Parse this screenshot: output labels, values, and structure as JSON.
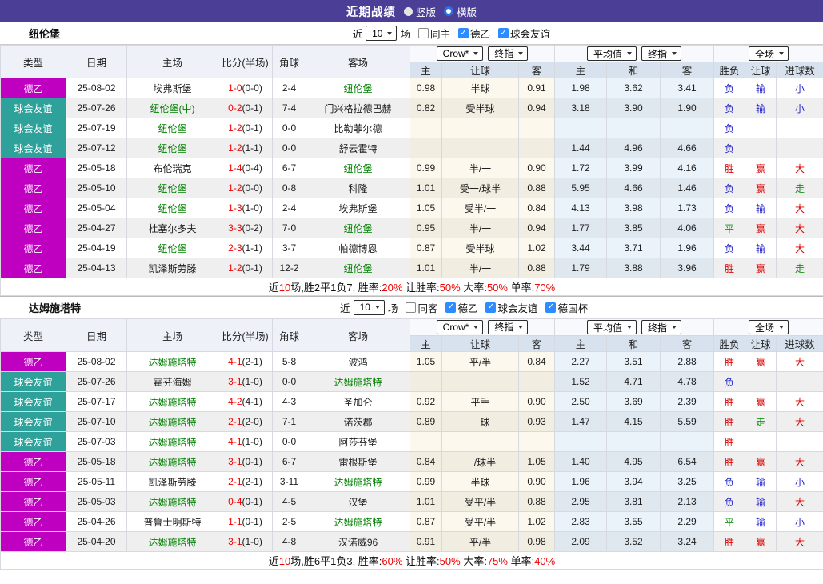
{
  "topbar": {
    "title": "近期战绩",
    "radio_vertical": "竖版",
    "radio_horizontal": "横版"
  },
  "table": {
    "left_columns": [
      "类型",
      "日期",
      "主场",
      "比分(半场)",
      "角球",
      "客场"
    ],
    "sub_columns": [
      "主",
      "让球",
      "客",
      "主",
      "和",
      "客",
      "胜负",
      "让球",
      "进球数"
    ],
    "selects": {
      "crow": "Crow*",
      "final1": "终指",
      "average": "平均值",
      "final2": "终指",
      "fullmatch": "全场"
    }
  },
  "badge_colors": {
    "德乙": "#c000c0",
    "球会友谊": "#2da19a"
  },
  "result_colors": {
    "胜": "red",
    "平": "green",
    "负": "blue",
    "赢": "red",
    "输": "blue",
    "走": "green",
    "大": "red",
    "小": "blue"
  },
  "teams": [
    {
      "name": "纽伦堡",
      "filter": {
        "near": "近",
        "count": "10",
        "games": "场",
        "uncheck_label": "同主",
        "checked": [
          "德乙",
          "球会友谊"
        ]
      },
      "rows": [
        {
          "type": "德乙",
          "date": "25-08-02",
          "home": "埃弗斯堡",
          "home_green": false,
          "score": "1-0",
          "half": "(0-0)",
          "corner": "2-4",
          "away": "纽伦堡",
          "away_green": true,
          "crow_home": "0.98",
          "handicap": "半球",
          "crow_away": "0.91",
          "avg_home": "1.98",
          "avg_draw": "3.62",
          "avg_away": "3.41",
          "res_wdl": "负",
          "res_handicap": "输",
          "res_goals": "小"
        },
        {
          "type": "球会友谊",
          "date": "25-07-26",
          "home": "纽伦堡(中)",
          "home_green": true,
          "score": "0-2",
          "half": "(0-1)",
          "corner": "7-4",
          "away": "门兴格拉德巴赫",
          "away_green": false,
          "crow_home": "0.82",
          "handicap": "受半球",
          "crow_away": "0.94",
          "avg_home": "3.18",
          "avg_draw": "3.90",
          "avg_away": "1.90",
          "res_wdl": "负",
          "res_handicap": "输",
          "res_goals": "小"
        },
        {
          "type": "球会友谊",
          "date": "25-07-19",
          "home": "纽伦堡",
          "home_green": true,
          "score": "1-2",
          "half": "(0-1)",
          "corner": "0-0",
          "away": "比勒菲尔德",
          "away_green": false,
          "crow_home": "",
          "handicap": "",
          "crow_away": "",
          "avg_home": "",
          "avg_draw": "",
          "avg_away": "",
          "res_wdl": "负",
          "res_handicap": "",
          "res_goals": ""
        },
        {
          "type": "球会友谊",
          "date": "25-07-12",
          "home": "纽伦堡",
          "home_green": true,
          "score": "1-2",
          "half": "(1-1)",
          "corner": "0-0",
          "away": "舒云霍特",
          "away_green": false,
          "crow_home": "",
          "handicap": "",
          "crow_away": "",
          "avg_home": "1.44",
          "avg_draw": "4.96",
          "avg_away": "4.66",
          "res_wdl": "负",
          "res_handicap": "",
          "res_goals": ""
        },
        {
          "type": "德乙",
          "date": "25-05-18",
          "home": "布伦瑞克",
          "home_green": false,
          "score": "1-4",
          "half": "(0-4)",
          "corner": "6-7",
          "away": "纽伦堡",
          "away_green": true,
          "crow_home": "0.99",
          "handicap": "半/一",
          "crow_away": "0.90",
          "avg_home": "1.72",
          "avg_draw": "3.99",
          "avg_away": "4.16",
          "res_wdl": "胜",
          "res_handicap": "赢",
          "res_goals": "大"
        },
        {
          "type": "德乙",
          "date": "25-05-10",
          "home": "纽伦堡",
          "home_green": true,
          "score": "1-2",
          "half": "(0-0)",
          "corner": "0-8",
          "away": "科隆",
          "away_green": false,
          "crow_home": "1.01",
          "handicap": "受一/球半",
          "crow_away": "0.88",
          "avg_home": "5.95",
          "avg_draw": "4.66",
          "avg_away": "1.46",
          "res_wdl": "负",
          "res_handicap": "赢",
          "res_goals": "走"
        },
        {
          "type": "德乙",
          "date": "25-05-04",
          "home": "纽伦堡",
          "home_green": true,
          "score": "1-3",
          "half": "(1-0)",
          "corner": "2-4",
          "away": "埃弗斯堡",
          "away_green": false,
          "crow_home": "1.05",
          "handicap": "受半/一",
          "crow_away": "0.84",
          "avg_home": "4.13",
          "avg_draw": "3.98",
          "avg_away": "1.73",
          "res_wdl": "负",
          "res_handicap": "输",
          "res_goals": "大"
        },
        {
          "type": "德乙",
          "date": "25-04-27",
          "home": "杜塞尔多夫",
          "home_green": false,
          "score": "3-3",
          "half": "(0-2)",
          "corner": "7-0",
          "away": "纽伦堡",
          "away_green": true,
          "crow_home": "0.95",
          "handicap": "半/一",
          "crow_away": "0.94",
          "avg_home": "1.77",
          "avg_draw": "3.85",
          "avg_away": "4.06",
          "res_wdl": "平",
          "res_handicap": "赢",
          "res_goals": "大"
        },
        {
          "type": "德乙",
          "date": "25-04-19",
          "home": "纽伦堡",
          "home_green": true,
          "score": "2-3",
          "half": "(1-1)",
          "corner": "3-7",
          "away": "帕德博恩",
          "away_green": false,
          "crow_home": "0.87",
          "handicap": "受半球",
          "crow_away": "1.02",
          "avg_home": "3.44",
          "avg_draw": "3.71",
          "avg_away": "1.96",
          "res_wdl": "负",
          "res_handicap": "输",
          "res_goals": "大"
        },
        {
          "type": "德乙",
          "date": "25-04-13",
          "home": "凯泽斯劳滕",
          "home_green": false,
          "score": "1-2",
          "half": "(0-1)",
          "corner": "12-2",
          "away": "纽伦堡",
          "away_green": true,
          "crow_home": "1.01",
          "handicap": "半/一",
          "crow_away": "0.88",
          "avg_home": "1.79",
          "avg_draw": "3.88",
          "avg_away": "3.96",
          "res_wdl": "胜",
          "res_handicap": "赢",
          "res_goals": "走"
        }
      ],
      "summary": [
        {
          "text": "近"
        },
        {
          "text": "10",
          "red": true
        },
        {
          "text": "场,胜2平1负7, 胜率:"
        },
        {
          "text": "20%",
          "red": true
        },
        {
          "text": " 让胜率:"
        },
        {
          "text": "50%",
          "red": true
        },
        {
          "text": " 大率:"
        },
        {
          "text": "50%",
          "red": true
        },
        {
          "text": " 单率:"
        },
        {
          "text": "70%",
          "red": true
        }
      ]
    },
    {
      "name": "达姆施塔特",
      "filter": {
        "near": "近",
        "count": "10",
        "games": "场",
        "uncheck_label": "同客",
        "checked": [
          "德乙",
          "球会友谊",
          "德国杯"
        ]
      },
      "rows": [
        {
          "type": "德乙",
          "date": "25-08-02",
          "home": "达姆施塔特",
          "home_green": true,
          "score": "4-1",
          "half": "(2-1)",
          "corner": "5-8",
          "away": "波鸿",
          "away_green": false,
          "crow_home": "1.05",
          "handicap": "平/半",
          "crow_away": "0.84",
          "avg_home": "2.27",
          "avg_draw": "3.51",
          "avg_away": "2.88",
          "res_wdl": "胜",
          "res_handicap": "赢",
          "res_goals": "大"
        },
        {
          "type": "球会友谊",
          "date": "25-07-26",
          "home": "霍芬海姆",
          "home_green": false,
          "score": "3-1",
          "half": "(1-0)",
          "corner": "0-0",
          "away": "达姆施塔特",
          "away_green": true,
          "crow_home": "",
          "handicap": "",
          "crow_away": "",
          "avg_home": "1.52",
          "avg_draw": "4.71",
          "avg_away": "4.78",
          "res_wdl": "负",
          "res_handicap": "",
          "res_goals": ""
        },
        {
          "type": "球会友谊",
          "date": "25-07-17",
          "home": "达姆施塔特",
          "home_green": true,
          "score": "4-2",
          "half": "(4-1)",
          "corner": "4-3",
          "away": "圣加仑",
          "away_green": false,
          "crow_home": "0.92",
          "handicap": "平手",
          "crow_away": "0.90",
          "avg_home": "2.50",
          "avg_draw": "3.69",
          "avg_away": "2.39",
          "res_wdl": "胜",
          "res_handicap": "赢",
          "res_goals": "大"
        },
        {
          "type": "球会友谊",
          "date": "25-07-10",
          "home": "达姆施塔特",
          "home_green": true,
          "score": "2-1",
          "half": "(2-0)",
          "corner": "7-1",
          "away": "诺茨郡",
          "away_green": false,
          "crow_home": "0.89",
          "handicap": "一球",
          "crow_away": "0.93",
          "avg_home": "1.47",
          "avg_draw": "4.15",
          "avg_away": "5.59",
          "res_wdl": "胜",
          "res_handicap": "走",
          "res_goals": "大"
        },
        {
          "type": "球会友谊",
          "date": "25-07-03",
          "home": "达姆施塔特",
          "home_green": true,
          "score": "4-1",
          "half": "(1-0)",
          "corner": "0-0",
          "away": "阿莎芬堡",
          "away_green": false,
          "crow_home": "",
          "handicap": "",
          "crow_away": "",
          "avg_home": "",
          "avg_draw": "",
          "avg_away": "",
          "res_wdl": "胜",
          "res_handicap": "",
          "res_goals": ""
        },
        {
          "type": "德乙",
          "date": "25-05-18",
          "home": "达姆施塔特",
          "home_green": true,
          "score": "3-1",
          "half": "(0-1)",
          "corner": "6-7",
          "away": "雷根斯堡",
          "away_green": false,
          "crow_home": "0.84",
          "handicap": "一/球半",
          "crow_away": "1.05",
          "avg_home": "1.40",
          "avg_draw": "4.95",
          "avg_away": "6.54",
          "res_wdl": "胜",
          "res_handicap": "赢",
          "res_goals": "大"
        },
        {
          "type": "德乙",
          "date": "25-05-11",
          "home": "凯泽斯劳滕",
          "home_green": false,
          "score": "2-1",
          "half": "(2-1)",
          "corner": "3-11",
          "away": "达姆施塔特",
          "away_green": true,
          "crow_home": "0.99",
          "handicap": "半球",
          "crow_away": "0.90",
          "avg_home": "1.96",
          "avg_draw": "3.94",
          "avg_away": "3.25",
          "res_wdl": "负",
          "res_handicap": "输",
          "res_goals": "小"
        },
        {
          "type": "德乙",
          "date": "25-05-03",
          "home": "达姆施塔特",
          "home_green": true,
          "score": "0-4",
          "half": "(0-1)",
          "corner": "4-5",
          "away": "汉堡",
          "away_green": false,
          "crow_home": "1.01",
          "handicap": "受平/半",
          "crow_away": "0.88",
          "avg_home": "2.95",
          "avg_draw": "3.81",
          "avg_away": "2.13",
          "res_wdl": "负",
          "res_handicap": "输",
          "res_goals": "大"
        },
        {
          "type": "德乙",
          "date": "25-04-26",
          "home": "普鲁士明斯特",
          "home_green": false,
          "score": "1-1",
          "half": "(0-1)",
          "corner": "2-5",
          "away": "达姆施塔特",
          "away_green": true,
          "crow_home": "0.87",
          "handicap": "受平/半",
          "crow_away": "1.02",
          "avg_home": "2.83",
          "avg_draw": "3.55",
          "avg_away": "2.29",
          "res_wdl": "平",
          "res_handicap": "输",
          "res_goals": "小"
        },
        {
          "type": "德乙",
          "date": "25-04-20",
          "home": "达姆施塔特",
          "home_green": true,
          "score": "3-1",
          "half": "(1-0)",
          "corner": "4-8",
          "away": "汉诺威96",
          "away_green": false,
          "crow_home": "0.91",
          "handicap": "平/半",
          "crow_away": "0.98",
          "avg_home": "2.09",
          "avg_draw": "3.52",
          "avg_away": "3.24",
          "res_wdl": "胜",
          "res_handicap": "赢",
          "res_goals": "大"
        }
      ],
      "summary": [
        {
          "text": "近"
        },
        {
          "text": "10",
          "red": true
        },
        {
          "text": "场,胜6平1负3, 胜率:"
        },
        {
          "text": "60%",
          "red": true
        },
        {
          "text": " 让胜率:"
        },
        {
          "text": "50%",
          "red": true
        },
        {
          "text": " 大率:"
        },
        {
          "text": "75%",
          "red": true
        },
        {
          "text": " 单率:"
        },
        {
          "text": "40%",
          "red": true
        }
      ]
    }
  ]
}
